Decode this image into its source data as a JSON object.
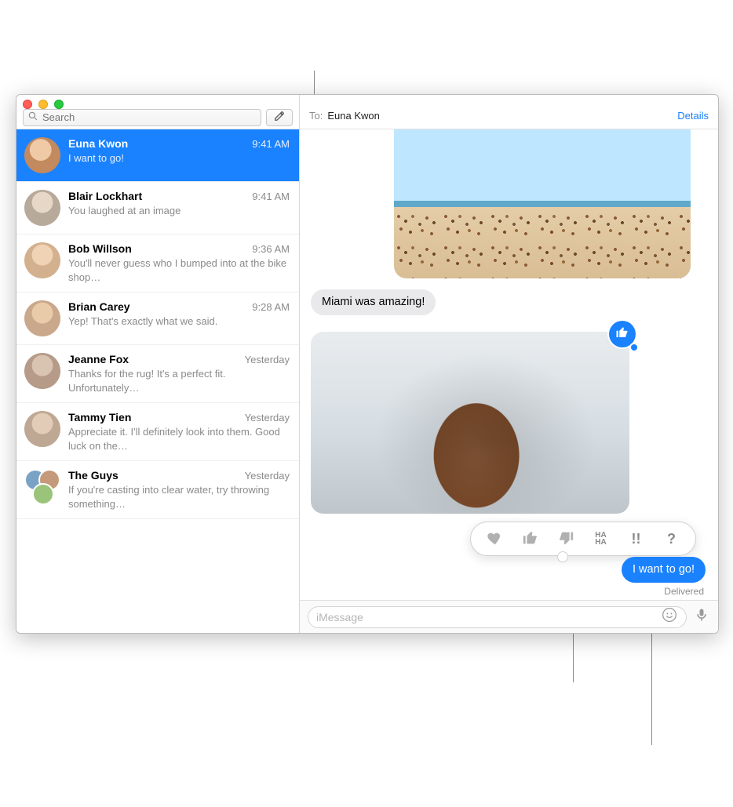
{
  "search": {
    "placeholder": "Search"
  },
  "toField": {
    "label": "To:",
    "name": "Euna Kwon"
  },
  "details": "Details",
  "composePlaceholder": "iMessage",
  "sidebar": {
    "items": [
      {
        "name": "Euna Kwon",
        "time": "9:41 AM",
        "preview": "I want to go!"
      },
      {
        "name": "Blair Lockhart",
        "time": "9:41 AM",
        "preview": "You laughed at an image"
      },
      {
        "name": "Bob Willson",
        "time": "9:36 AM",
        "preview": "You'll never guess who I bumped into at the bike shop…"
      },
      {
        "name": "Brian Carey",
        "time": "9:28 AM",
        "preview": "Yep! That's exactly what we said."
      },
      {
        "name": "Jeanne Fox",
        "time": "Yesterday",
        "preview": "Thanks for the rug! It's a perfect fit. Unfortunately…"
      },
      {
        "name": "Tammy Tien",
        "time": "Yesterday",
        "preview": "Appreciate it. I'll definitely look into them. Good luck on the…"
      },
      {
        "name": "The Guys",
        "time": "Yesterday",
        "preview": "If you're casting into clear water, try throwing something…"
      }
    ]
  },
  "messages": {
    "miami": "Miami was amazing!",
    "want": "I want to go!",
    "delivered": "Delivered"
  },
  "tapbacks": {
    "haha": "HA\nHA",
    "exclaim": "!!",
    "question": "?"
  },
  "avatarColors": {
    "c0": "#c28a5e",
    "c1": "#b7aa9a",
    "c2": "#d3b18e",
    "c3": "#caa88b",
    "c4": "#b59b88",
    "c5": "#bfa893"
  }
}
